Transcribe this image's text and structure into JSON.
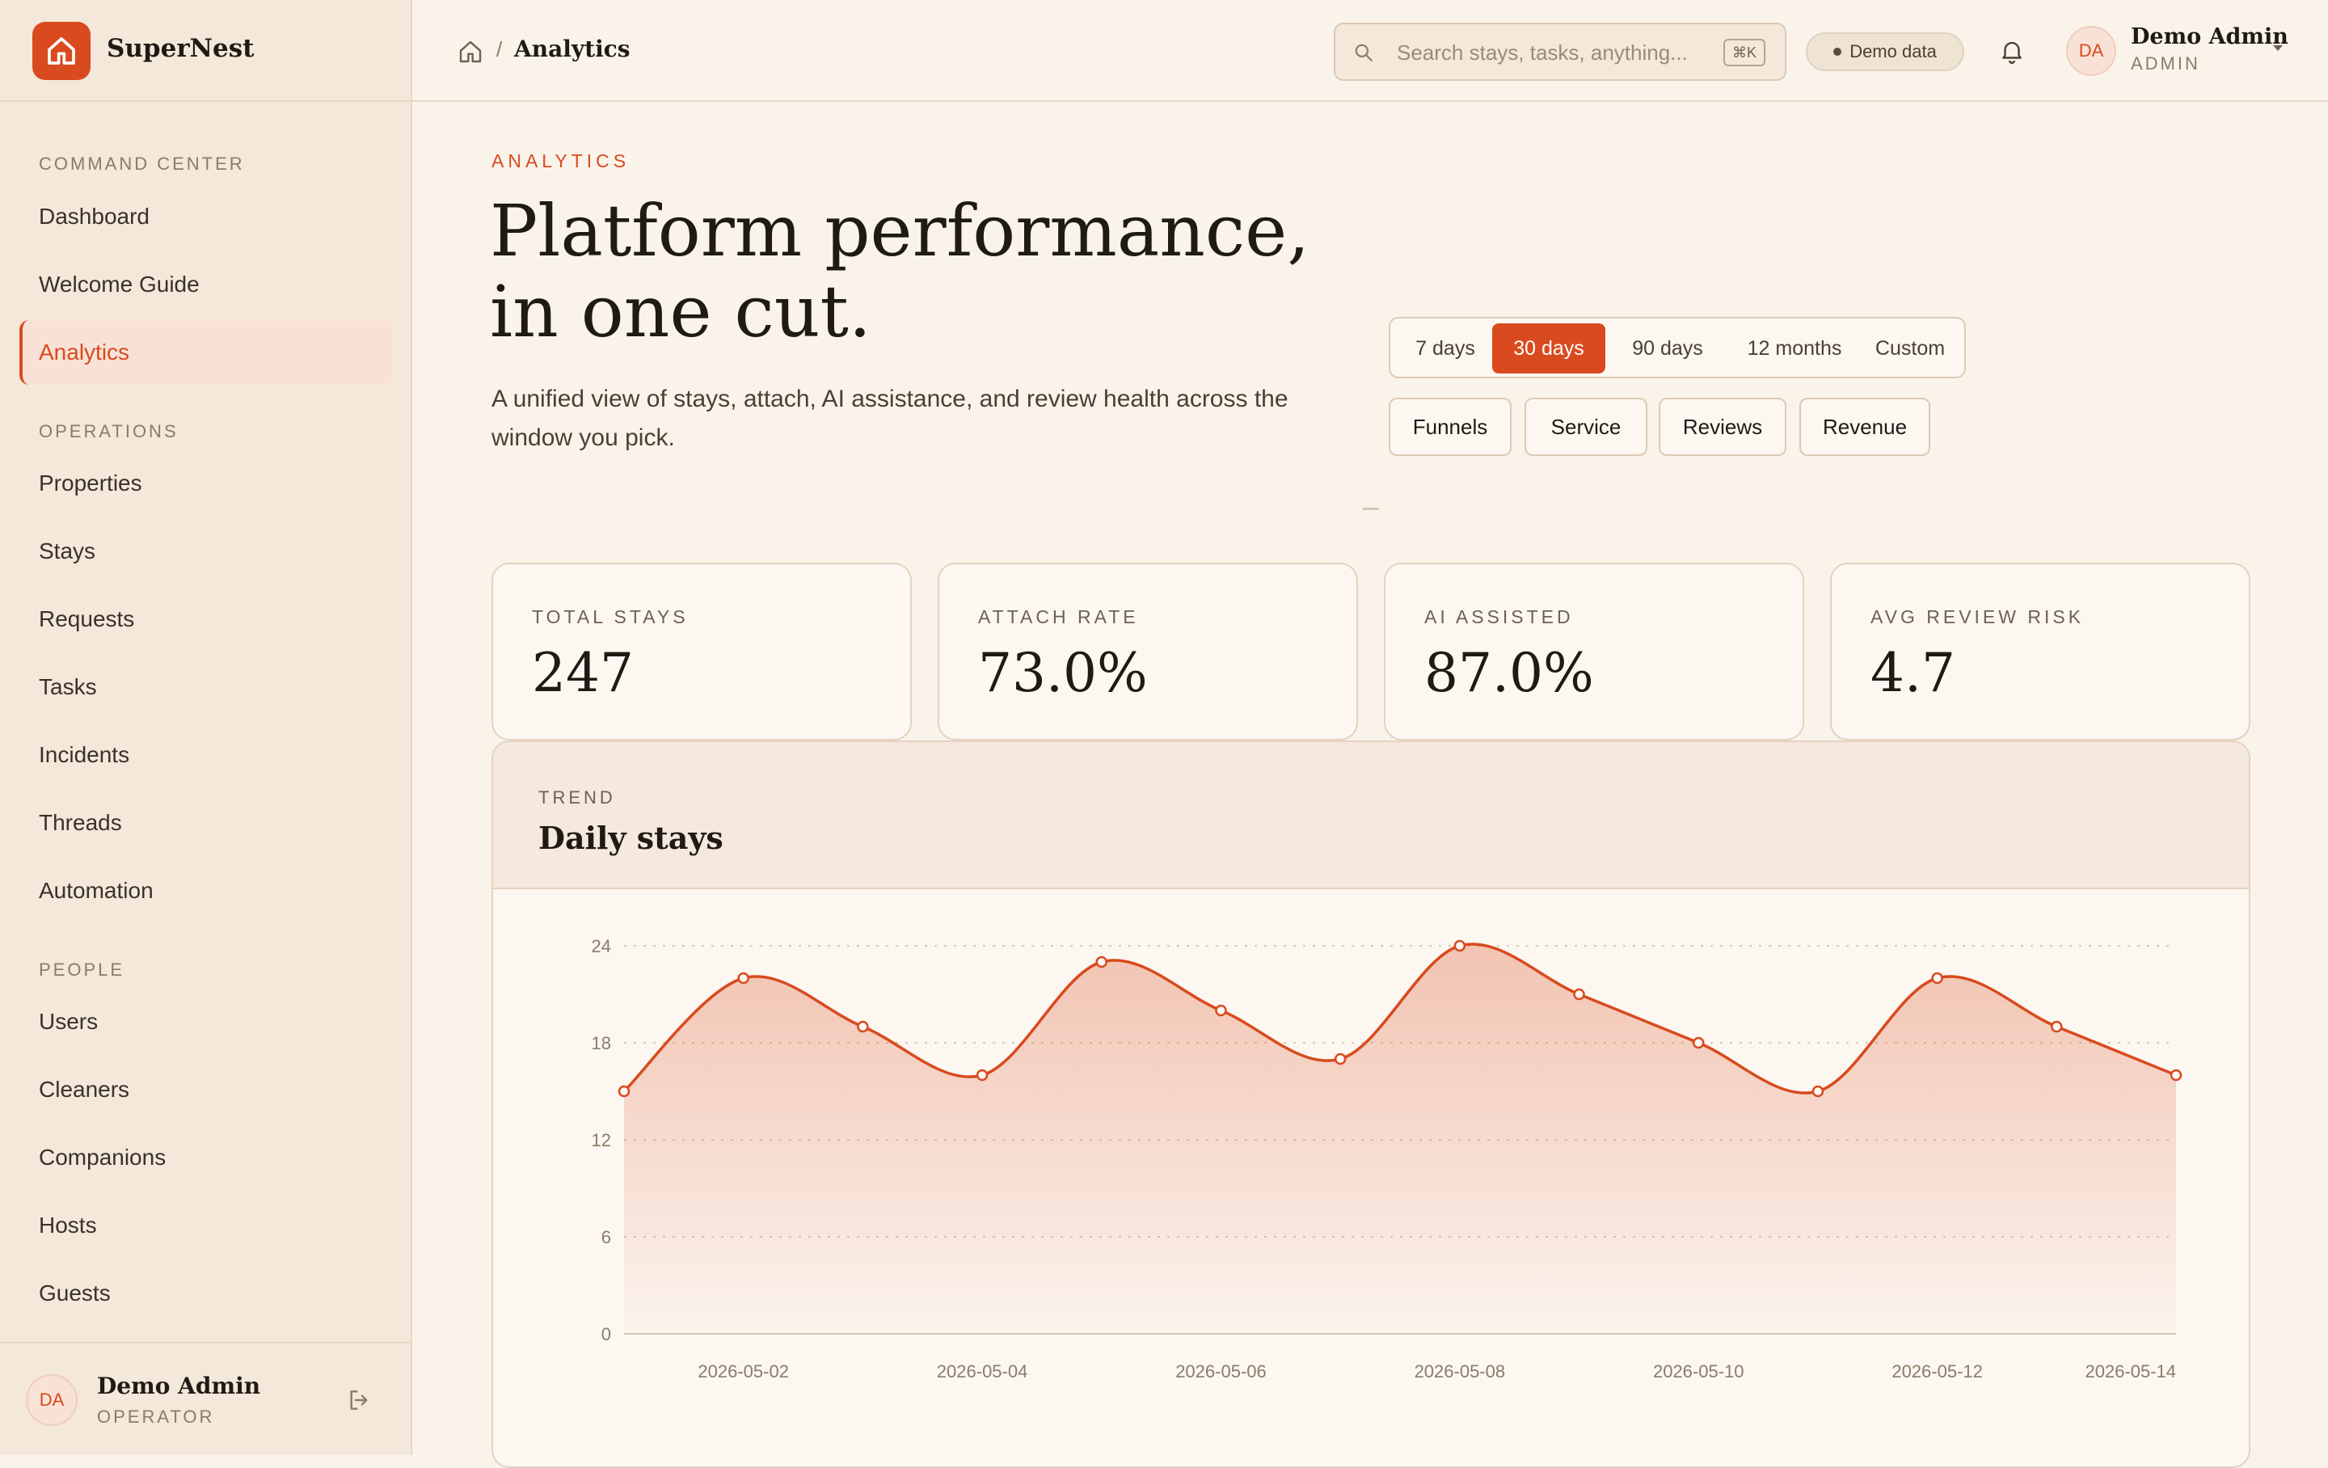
{
  "brand": {
    "name": "SuperNest",
    "logo_icon": "home-icon",
    "accent": "#d94a1e"
  },
  "sidebar": {
    "sections": [
      {
        "title": "COMMAND CENTER",
        "items": [
          {
            "label": "Dashboard",
            "active": false
          },
          {
            "label": "Welcome Guide",
            "active": false
          },
          {
            "label": "Analytics",
            "active": true
          }
        ]
      },
      {
        "title": "OPERATIONS",
        "items": [
          {
            "label": "Properties",
            "active": false
          },
          {
            "label": "Stays",
            "active": false
          },
          {
            "label": "Requests",
            "active": false
          },
          {
            "label": "Tasks",
            "active": false
          },
          {
            "label": "Incidents",
            "active": false
          },
          {
            "label": "Threads",
            "active": false
          },
          {
            "label": "Automation",
            "active": false
          }
        ]
      },
      {
        "title": "PEOPLE",
        "items": [
          {
            "label": "Users",
            "active": false
          },
          {
            "label": "Cleaners",
            "active": false
          },
          {
            "label": "Companions",
            "active": false
          },
          {
            "label": "Hosts",
            "active": false
          },
          {
            "label": "Guests",
            "active": false
          }
        ]
      }
    ],
    "footer": {
      "initials": "DA",
      "name": "Demo Admin",
      "role": "OPERATOR",
      "logout_icon": "logout-icon"
    }
  },
  "header": {
    "breadcrumb": {
      "home_icon": "home-icon",
      "separator": "/",
      "current": "Analytics"
    },
    "search": {
      "placeholder": "Search stays, tasks, anything...",
      "shortcut": "⌘K"
    },
    "demo_badge": "Demo data",
    "bell_icon": "bell-icon",
    "user": {
      "initials": "DA",
      "name": "Demo Admin",
      "role": "ADMIN"
    }
  },
  "page": {
    "eyebrow": "ANALYTICS",
    "title_line1": "Platform performance,",
    "title_line2": "in one cut.",
    "description_line1": "A unified view of stays, attach, AI assistance, and review health across the",
    "description_line2": "window you pick.",
    "ranges": [
      "7 days",
      "30 days",
      "90 days",
      "12 months",
      "Custom"
    ],
    "selected_range": "30 days",
    "tabs": [
      "Funnels",
      "Service",
      "Reviews",
      "Revenue"
    ]
  },
  "kpis": [
    {
      "label": "TOTAL STAYS",
      "value": "247"
    },
    {
      "label": "ATTACH RATE",
      "value": "73.0%"
    },
    {
      "label": "AI ASSISTED",
      "value": "87.0%"
    },
    {
      "label": "AVG REVIEW RISK",
      "value": "4.7"
    }
  ],
  "trend": {
    "eyebrow": "TREND",
    "title": "Daily stays"
  },
  "chart_data": {
    "type": "area",
    "title": "Daily stays",
    "x": [
      "2026-05-01",
      "2026-05-02",
      "2026-05-03",
      "2026-05-04",
      "2026-05-05",
      "2026-05-06",
      "2026-05-07",
      "2026-05-08",
      "2026-05-09",
      "2026-05-10",
      "2026-05-11",
      "2026-05-12",
      "2026-05-13",
      "2026-05-14"
    ],
    "series": [
      {
        "values": [
          15,
          22,
          19,
          16,
          23,
          20,
          17,
          24,
          21,
          18,
          15,
          22,
          19,
          16
        ]
      }
    ],
    "xticks": [
      "2026-05-02",
      "2026-05-04",
      "2026-05-06",
      "2026-05-08",
      "2026-05-10",
      "2026-05-12",
      "2026-05-14"
    ],
    "yticks": [
      0,
      6,
      12,
      18,
      24
    ],
    "ylim": [
      0,
      24
    ],
    "grid": true,
    "color": "#d94a1e"
  }
}
